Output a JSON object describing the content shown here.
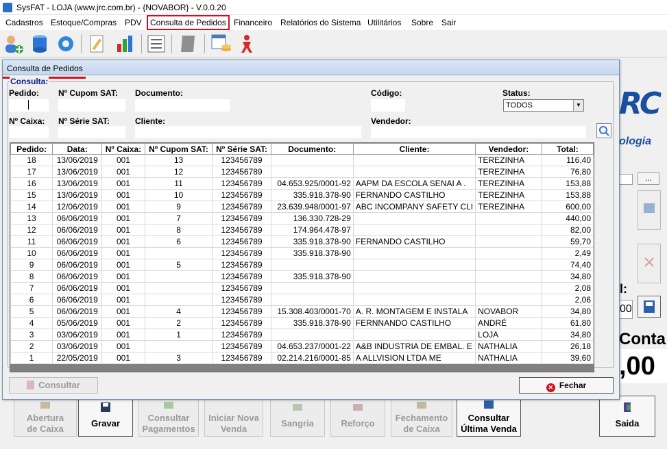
{
  "window": {
    "title": "SysFAT - LOJA (www.jrc.com.br) - {NOVABOR} - V.0.0.20"
  },
  "menu": [
    {
      "label": "Cadastros"
    },
    {
      "label": "Estoque/Compras"
    },
    {
      "label": "PDV"
    },
    {
      "label": "Consulta de Pedidos"
    },
    {
      "label": "Financeiro"
    },
    {
      "label": "Relatórios do Sistema"
    },
    {
      "label": "Utilitários"
    },
    {
      "label": "Sobre"
    },
    {
      "label": "Sair"
    }
  ],
  "background": {
    "logo_letters": "RC",
    "logo_tagline": "ologia",
    "dots_label": "...",
    "cut_label": "l:",
    "cut_value": "00",
    "conta_label": "Conta:",
    "conta_value": ",00",
    "buttons": [
      {
        "label1": "Abertura",
        "label2": "de Caixa",
        "enabled": false
      },
      {
        "label1": "Gravar",
        "label2": "",
        "enabled": true
      },
      {
        "label1": "Consultar",
        "label2": "Pagamentos",
        "enabled": false
      },
      {
        "label1": "Iniciar Nova",
        "label2": "Venda",
        "enabled": false
      },
      {
        "label1": "Sangria",
        "label2": "",
        "enabled": false
      },
      {
        "label1": "Reforço",
        "label2": "",
        "enabled": false
      },
      {
        "label1": "Fechamento",
        "label2": "de Caixa",
        "enabled": false
      },
      {
        "label1": "Consultar",
        "label2": "Última Venda",
        "enabled": true
      },
      {
        "label1": "Saida",
        "label2": "",
        "enabled": true
      }
    ]
  },
  "dialog": {
    "title": "Consulta de Pedidos",
    "group_title": "Consulta:",
    "labels": {
      "pedido": "Pedido:",
      "cupom": "Nº Cupom SAT:",
      "documento": "Documento:",
      "codigo": "Código:",
      "status": "Status:",
      "caixa": "Nº Caixa:",
      "serie": "Nº Série SAT:",
      "cliente": "Cliente:",
      "vendedor": "Vendedor:"
    },
    "status_value": "TODOS",
    "columns": [
      "Pedido:",
      "Data:",
      "Nº Caixa:",
      "Nº Cupom SAT:",
      "Nº Série SAT:",
      "Documento:",
      "Cliente:",
      "Vendedor:",
      "Total:"
    ],
    "rows": [
      [
        "18",
        "13/06/2019",
        "001",
        "13",
        "123456789",
        "",
        "",
        "TEREZINHA",
        "116,40"
      ],
      [
        "17",
        "13/06/2019",
        "001",
        "12",
        "123456789",
        "",
        "",
        "TEREZINHA",
        "76,80"
      ],
      [
        "16",
        "13/06/2019",
        "001",
        "11",
        "123456789",
        "04.653.925/0001-92",
        "AAPM DA ESCOLA SENAI  A .",
        "TEREZINHA",
        "153,88"
      ],
      [
        "15",
        "13/06/2019",
        "001",
        "10",
        "123456789",
        "335.918.378-90",
        "FERNANDO CASTILHO",
        "TEREZINHA",
        "153,88"
      ],
      [
        "14",
        "12/06/2019",
        "001",
        "9",
        "123456789",
        "23.639.948/0001-97",
        "ABC INCOMPANY SAFETY CLI",
        "TEREZINHA",
        "600,00"
      ],
      [
        "13",
        "06/06/2019",
        "001",
        "7",
        "123456789",
        "136.330.728-29",
        "",
        "",
        "440,00"
      ],
      [
        "12",
        "06/06/2019",
        "001",
        "8",
        "123456789",
        "174.964.478-97",
        "",
        "",
        "82,00"
      ],
      [
        "11",
        "06/06/2019",
        "001",
        "6",
        "123456789",
        "335.918.378-90",
        "FERNANDO CASTILHO",
        "",
        "59,70"
      ],
      [
        "10",
        "06/06/2019",
        "001",
        "",
        "123456789",
        "335.918.378-90",
        "",
        "",
        "2,49"
      ],
      [
        "9",
        "06/06/2019",
        "001",
        "5",
        "123456789",
        "",
        "",
        "",
        "74,40"
      ],
      [
        "8",
        "06/06/2019",
        "001",
        "",
        "123456789",
        "335.918.378-90",
        "",
        "",
        "34,80"
      ],
      [
        "7",
        "06/06/2019",
        "001",
        "",
        "123456789",
        "",
        "",
        "",
        "2,08"
      ],
      [
        "6",
        "06/06/2019",
        "001",
        "",
        "123456789",
        "",
        "",
        "",
        "2,06"
      ],
      [
        "5",
        "06/06/2019",
        "001",
        "4",
        "123456789",
        "15.308.403/0001-70",
        "A. R. MONTAGEM E INSTALA",
        "NOVABOR",
        "34,80"
      ],
      [
        "4",
        "05/06/2019",
        "001",
        "2",
        "123456789",
        "335.918.378-90",
        "FERNNANDO CASTILHO",
        "ANDRÉ",
        "61,80"
      ],
      [
        "3",
        "03/06/2019",
        "001",
        "1",
        "123456789",
        "",
        "",
        "LOJA",
        "34,80"
      ],
      [
        "2",
        "03/06/2019",
        "001",
        "",
        "123456789",
        "04.653.237/0001-22",
        "A&B INDUSTRIA DE EMBAL. E",
        "NATHALIA",
        "26,18"
      ],
      [
        "1",
        "22/05/2019",
        "001",
        "3",
        "123456789",
        "02.214.216/0001-85",
        "A ALLVISION LTDA ME",
        "NATHALIA",
        "39,60"
      ]
    ],
    "consultar_label": "Consultar",
    "fechar_label": "Fechar"
  }
}
